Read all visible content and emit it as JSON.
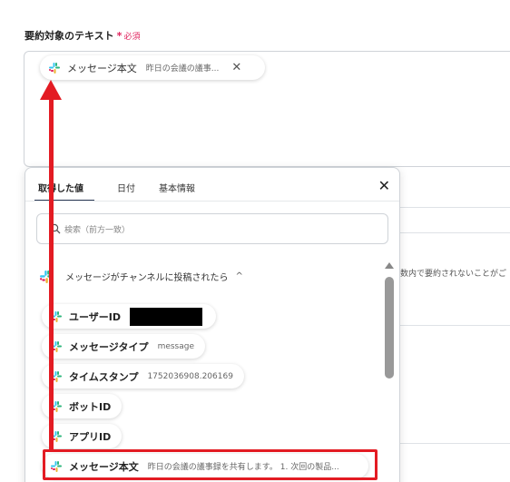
{
  "field": {
    "label": "要約対象のテキスト",
    "required_star": "*",
    "required_text": "必須"
  },
  "top_chip": {
    "label": "メッセージ本文",
    "value": "昨日の会議の議事...",
    "close_glyph": "✕"
  },
  "background": {
    "hint_text": "数内で要約されないことがご"
  },
  "popup": {
    "tabs": [
      {
        "label": "取得した値"
      },
      {
        "label": "日付"
      },
      {
        "label": "基本情報"
      }
    ],
    "close_glyph": "✕",
    "search_placeholder": "検索（前方一致）",
    "group_title": "メッセージがチャンネルに投稿されたら",
    "group_chevron": "^",
    "items": [
      {
        "label": "ユーザーID",
        "value": ""
      },
      {
        "label": "メッセージタイプ",
        "value": "message"
      },
      {
        "label": "タイムスタンプ",
        "value": "1752036908.206169"
      },
      {
        "label": "ボットID",
        "value": ""
      },
      {
        "label": "アプリID",
        "value": ""
      },
      {
        "label": "メッセージ本文",
        "value": "昨日の会議の議事録を共有します。 1. 次回の製品..."
      }
    ]
  },
  "colors": {
    "annotation_red": "#e31b23",
    "required_pink": "#e0245e",
    "tab_underline": "#2b3a55"
  },
  "icons": {
    "slack": "slack-icon",
    "search": "search-icon",
    "close": "close-icon",
    "chevron": "chevron-up-icon"
  }
}
